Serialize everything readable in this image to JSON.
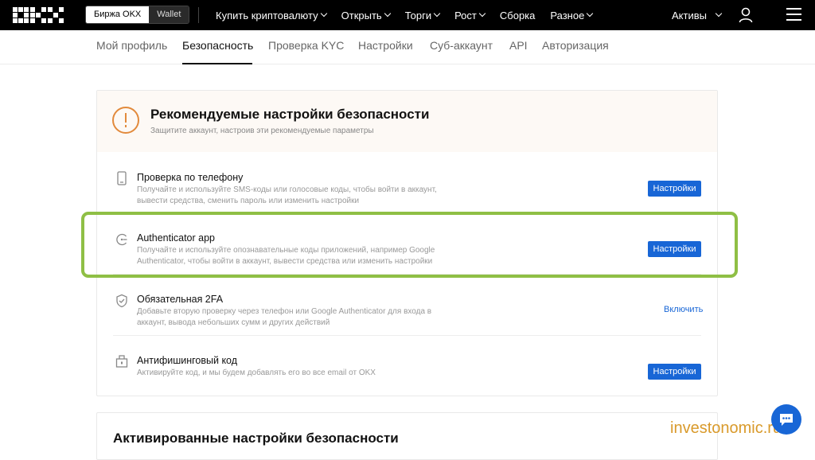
{
  "header": {
    "logo": "OKX",
    "segment": [
      "Биржа OKX",
      "Wallet"
    ],
    "nav": [
      "Купить криптовалюту",
      "Открыть",
      "Торги",
      "Рост",
      "Сборка",
      "Разное"
    ],
    "assets": "Активы"
  },
  "subtabs": [
    "Мой профиль",
    "Безопасность",
    "Проверка KYC",
    "Настройки",
    "Суб-аккаунт",
    "API",
    "Авторизация"
  ],
  "recommended": {
    "title": "Рекомендуемые настройки безопасности",
    "subtitle": "Защитите аккаунт, настроив эти рекомендуемые параметры",
    "items": [
      {
        "icon": "phone-icon",
        "title": "Проверка по телефону",
        "desc": "Получайте и используйте SMS-коды или голосовые коды, чтобы войти в аккаунт, вывести средства, сменить пароль или изменить настройки",
        "action": "Настройки"
      },
      {
        "icon": "authenticator-icon",
        "title": "Authenticator app",
        "desc": "Получайте и используйте опознавательные коды приложений, например Google Authenticator, чтобы войти в аккаунт, вывести средства или изменить настройки",
        "action": "Настройки"
      },
      {
        "icon": "shield-icon",
        "title": "Обязательная 2FA",
        "desc": "Добавьте вторую проверку через телефон или Google Authenticator для входа в аккаунт, вывода небольших сумм и других действий",
        "action": "Включить"
      },
      {
        "icon": "anti-phishing-icon",
        "title": "Антифишинговый код",
        "desc": "Активируйте код, и мы будем добавлять его во все email от OKX",
        "action": "Настройки"
      }
    ]
  },
  "activated": {
    "title": "Активированные настройки безопасности"
  },
  "watermark": "investonomic.ru",
  "colors": {
    "accent": "#1866d6",
    "warning": "#e28a3c",
    "highlight": "#8fbf45"
  }
}
